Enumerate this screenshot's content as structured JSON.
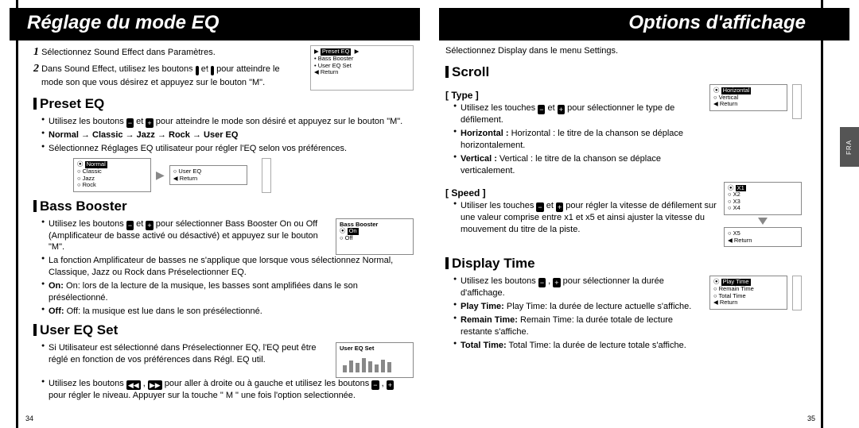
{
  "left": {
    "title": "Réglage du mode EQ",
    "step1_num": "1",
    "step1": "Sélectionnez Sound Effect dans Paramètres.",
    "step2_num": "2",
    "step2a": "Dans Sound Effect, utilisez les boutons",
    "step2b": "et",
    "step2c": "pour atteindre le mode son que vous désirez et appuyez sur le bouton \"M\".",
    "menu1": {
      "l1": "Preset EQ",
      "l2": "Bass Booster",
      "l3": "User EQ Set",
      "l4": "Return"
    },
    "preset": {
      "heading": "Preset EQ",
      "b1a": "Utilisez les boutons",
      "b1b": "et",
      "b1c": "pour atteindre le mode son désiré et appuyez sur le bouton \"M\".",
      "b2": "Normal → Classic → Jazz → Rock → User EQ",
      "b3": "Sélectionnez Réglages EQ utilisateur pour régler l'EQ selon vos préférences.",
      "menuA": {
        "l1": "Normal",
        "l2": "Classic",
        "l3": "Jazz",
        "l4": "Rock"
      },
      "menuB": {
        "l1": "User EQ",
        "l2": "Return"
      }
    },
    "bass": {
      "heading": "Bass Booster",
      "b1a": "Utilisez les boutons",
      "b1b": "et",
      "b1c": "pour sélectionner Bass Booster On ou Off (Amplificateur de basse activé ou désactivé) et appuyez sur le bouton \"M\".",
      "b2": "La fonction Amplificateur de basses ne s'applique que lorsque vous sélectionnez Normal, Classique, Jazz ou Rock dans Préselectionner EQ.",
      "b3": "On: lors de la lecture de la musique, les basses sont amplifiées dans le son présélectionné.",
      "b4": "Off: la musique est lue dans le son présélectionné.",
      "menu": {
        "title": "Bass Booster",
        "l1": "On",
        "l2": "Off"
      }
    },
    "usereq": {
      "heading": "User EQ Set",
      "b1": "Si Utilisateur est sélectionné dans Préselectionner EQ, l'EQ peut être réglé en fonction de vos préférences dans Régl. EQ util.",
      "b2a": "Utilisez les boutons",
      "b2b": ",",
      "b2c": "pour aller à droite ou à gauche et utilisez les boutons",
      "b2d": ",",
      "b2e": "pour régler le niveau. Appuyer sur la touche \" M \" une fois l'option selectionnée.",
      "menu_title": "User EQ Set"
    },
    "page": "34"
  },
  "right": {
    "title": "Options d&#39;affichage",
    "intro": "Sélectionnez Display dans le menu Settings.",
    "scroll": {
      "heading": "Scroll",
      "type": {
        "label": "[ Type ]",
        "b1a": "Utilisez les touches",
        "b1b": "et",
        "b1c": "pour sélectionner le type de défilement.",
        "b2": "Horizontal : le titre de la chanson se déplace horizontalement.",
        "b3": "Vertical : le titre de la chanson se déplace verticalement.",
        "menu": {
          "l1": "Horizontal",
          "l2": "Vertical",
          "l3": "Return"
        }
      },
      "speed": {
        "label": "[ Speed ]",
        "b1a": "Utiliser les touches",
        "b1b": "et",
        "b1c": "pour régler la vitesse de défilement sur une valeur comprise entre x1 et x5 et ainsi ajuster la vitesse du mouvement du titre de la piste.",
        "menuA": {
          "l1": "X1",
          "l2": "X2",
          "l3": "X3",
          "l4": "X4"
        },
        "menuB": {
          "l1": "X5",
          "l2": "Return"
        }
      }
    },
    "display_time": {
      "heading": "Display Time",
      "b1a": "Utilisez les boutons",
      "b1b": ",",
      "b1c": "pour sélectionner la durée d'affichage.",
      "b2": "Play Time: la durée de lecture actuelle s'affiche.",
      "b3": "Remain Time: la durée totale de lecture restante s'affiche.",
      "b4": "Total Time: la durée de lecture totale s'affiche.",
      "menu": {
        "l1": "Play Time",
        "l2": "Remain Time",
        "l3": "Total Time",
        "l4": "Return"
      }
    },
    "page": "35",
    "tab": "FRA"
  }
}
